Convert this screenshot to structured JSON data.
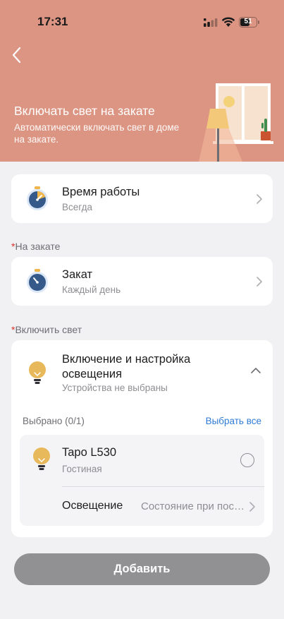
{
  "status_bar": {
    "time": "17:31",
    "battery": "51"
  },
  "header": {
    "title": "Включать свет на закате",
    "subtitle": "Автоматически включать свет в доме на закате."
  },
  "work_time": {
    "title": "Время работы",
    "value": "Всегда"
  },
  "sunset_section": {
    "required_mark": "*",
    "label": "На закате",
    "title": "Закат",
    "value": "Каждый день"
  },
  "light_section": {
    "required_mark": "*",
    "label": "Включить свет",
    "title": "Включение и настройка освещения",
    "subtitle": "Устройства не выбраны",
    "selected_count": "Выбрано (0/1)",
    "select_all": "Выбрать все",
    "device": {
      "name": "Tapo L530",
      "room": "Гостиная",
      "selected": false
    },
    "lighting_label": "Освещение",
    "lighting_value": "Состояние при последнем отключении"
  },
  "add_button": "Добавить",
  "colors": {
    "header_bg": "#dc9582",
    "accent_link": "#2f7cd3",
    "required": "#d9312b",
    "button_disabled": "#919194",
    "bulb": "#e8b95a"
  }
}
